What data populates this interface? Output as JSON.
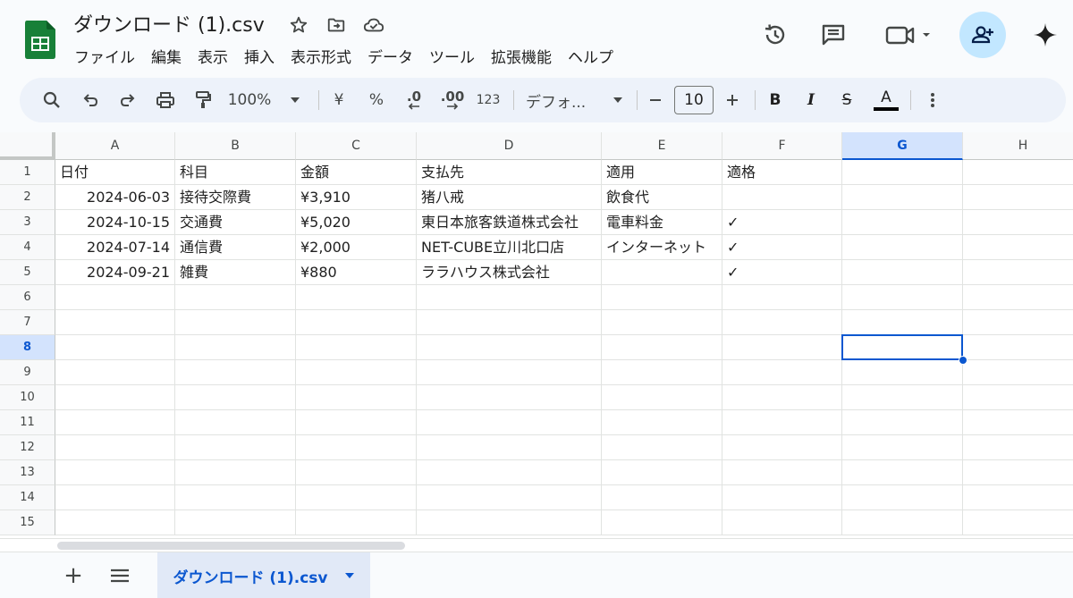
{
  "header": {
    "file_title": "ダウンロード (1).csv",
    "menu": [
      "ファイル",
      "編集",
      "表示",
      "挿入",
      "表示形式",
      "データ",
      "ツール",
      "拡張機能",
      "ヘルプ"
    ],
    "icons": [
      "star-icon",
      "move-to-folder-icon",
      "cloud-status-icon",
      "version-history-icon",
      "comments-icon",
      "meet-icon",
      "share-icon",
      "gemini-icon"
    ]
  },
  "toolbar": {
    "zoom": "100%",
    "currency": "¥",
    "percent": "%",
    "decrease_decimal": ".0",
    "increase_decimal": ".00",
    "number_format": "123",
    "font": "デフォ...",
    "font_size": "10",
    "bold": "B",
    "italic": "I",
    "strike": "S",
    "text_color": "A"
  },
  "grid": {
    "columns": [
      "A",
      "B",
      "C",
      "D",
      "E",
      "F",
      "G",
      "H"
    ],
    "rows": [
      "1",
      "2",
      "3",
      "4",
      "5",
      "6",
      "7",
      "8",
      "9",
      "10",
      "11",
      "12",
      "13",
      "14",
      "15"
    ],
    "selected_cell": "G8",
    "data": [
      [
        "日付",
        "科目",
        "金額",
        "支払先",
        "適用",
        "適格"
      ],
      [
        "2024-06-03",
        "接待交際費",
        "¥3,910",
        "猪八戒",
        "飲食代",
        ""
      ],
      [
        "2024-10-15",
        "交通費",
        "¥5,020",
        "東日本旅客鉄道株式会社",
        "電車料金",
        "✓"
      ],
      [
        "2024-07-14",
        "通信費",
        "¥2,000",
        "NET-CUBE立川北口店",
        "インターネット",
        "✓"
      ],
      [
        "2024-09-21",
        "雑費",
        "¥880",
        "ララハウス株式会社",
        "",
        "✓"
      ]
    ]
  },
  "sheet_bar": {
    "add_sheet": "+",
    "sheet_tab": "ダウンロード (1).csv"
  },
  "colors": {
    "accent": "#0b57d0",
    "selected_header_bg": "#d3e3fd",
    "share_button_bg": "#c2e7ff",
    "logo_green": "#188038"
  }
}
